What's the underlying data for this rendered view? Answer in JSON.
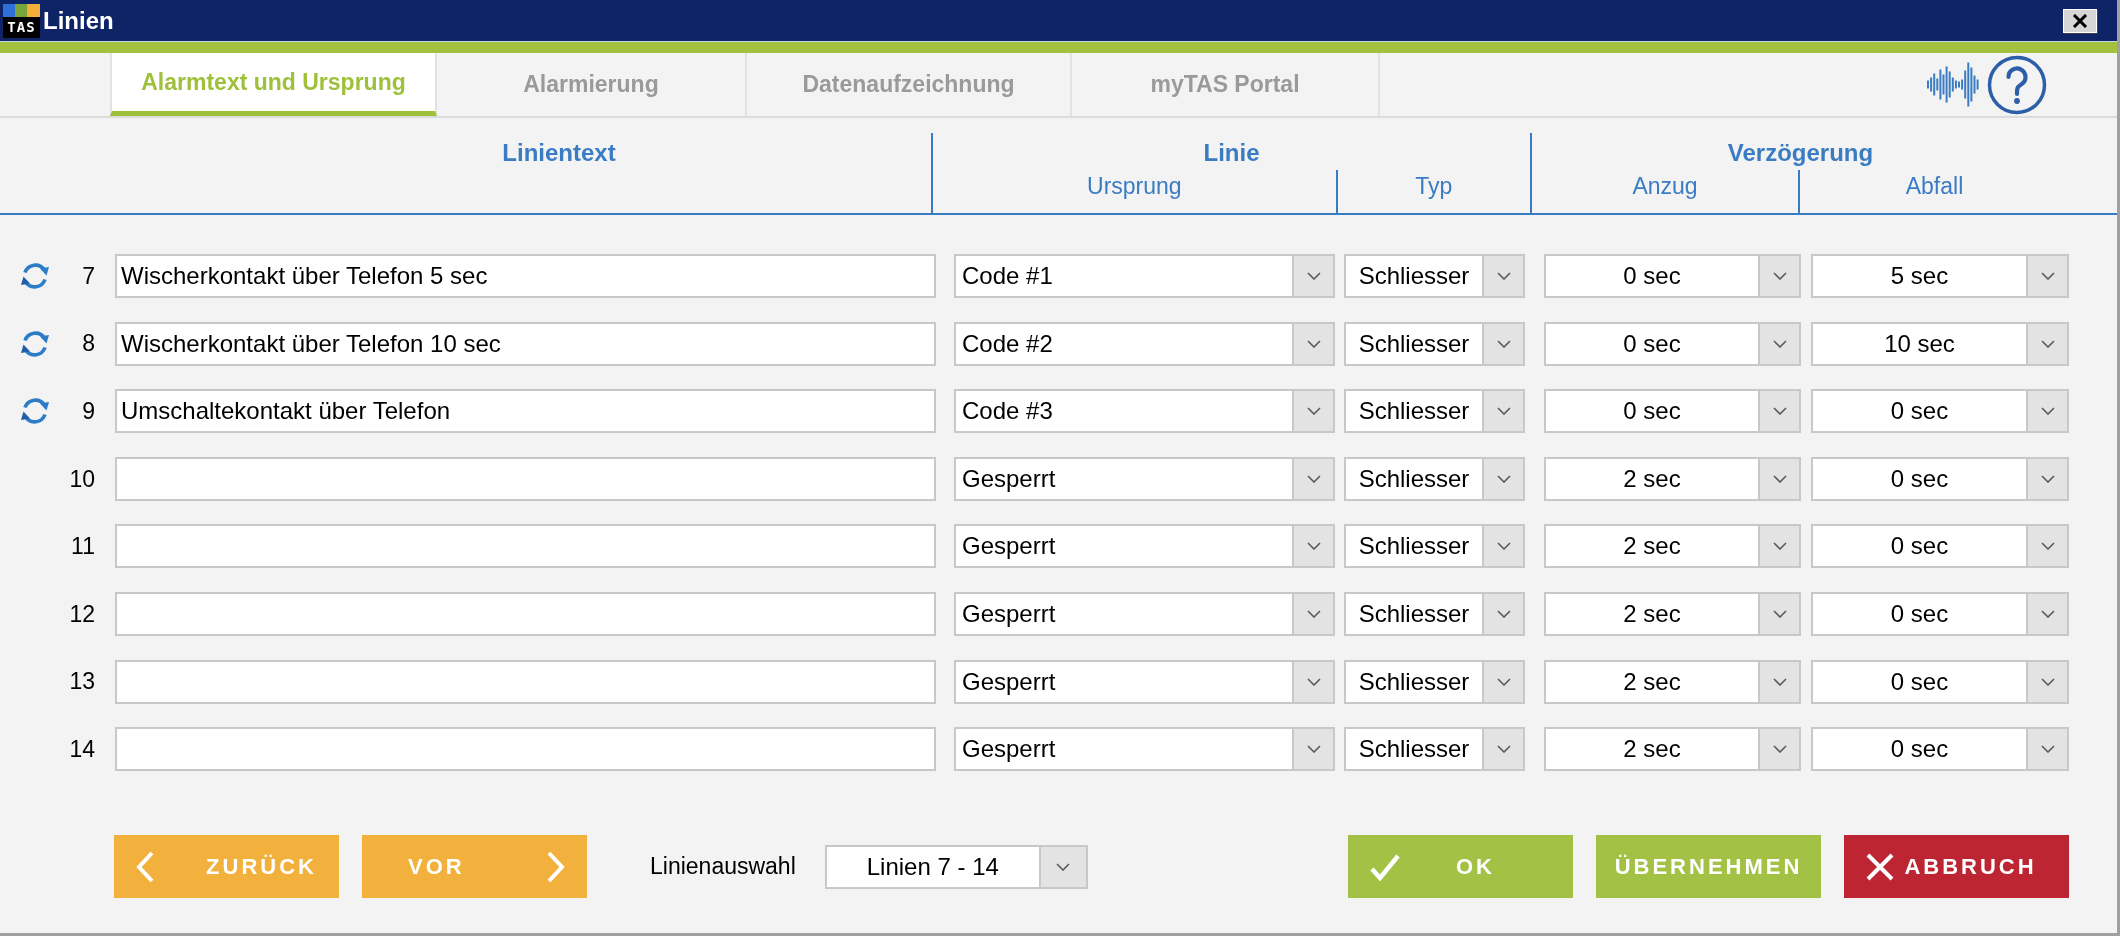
{
  "window": {
    "title": "Linien",
    "logo": "TAS"
  },
  "tabs": [
    {
      "label": "Alarmtext und Ursprung",
      "selected": true
    },
    {
      "label": "Alarmierung",
      "selected": false
    },
    {
      "label": "Datenaufzeichnung",
      "selected": false
    },
    {
      "label": "myTAS Portal",
      "selected": false
    }
  ],
  "header": {
    "text_column": "Linientext",
    "groups": [
      {
        "title": "Linie",
        "columns": [
          "Ursprung",
          "Typ"
        ]
      },
      {
        "title": "Verzögerung",
        "columns": [
          "Anzug",
          "Abfall"
        ]
      }
    ]
  },
  "rows": [
    {
      "number": "7",
      "sync": true,
      "text": "Wischerkontakt über Telefon 5 sec",
      "origin": "Code #1",
      "type": "Schliesser",
      "pickup": "0 sec",
      "dropout": "5 sec"
    },
    {
      "number": "8",
      "sync": true,
      "text": "Wischerkontakt über Telefon 10 sec",
      "origin": "Code #2",
      "type": "Schliesser",
      "pickup": "0 sec",
      "dropout": "10 sec"
    },
    {
      "number": "9",
      "sync": true,
      "text": "Umschaltekontakt über Telefon",
      "origin": "Code #3",
      "type": "Schliesser",
      "pickup": "0 sec",
      "dropout": "0 sec"
    },
    {
      "number": "10",
      "sync": false,
      "origin": "Gesperrt",
      "type": "Schliesser",
      "pickup": "2 sec",
      "dropout": "0 sec"
    },
    {
      "number": "11",
      "sync": false,
      "origin": "Gesperrt",
      "type": "Schliesser",
      "pickup": "2 sec",
      "dropout": "0 sec"
    },
    {
      "number": "12",
      "sync": false,
      "origin": "Gesperrt",
      "type": "Schliesser",
      "pickup": "2 sec",
      "dropout": "0 sec"
    },
    {
      "number": "13",
      "sync": false,
      "origin": "Gesperrt",
      "type": "Schliesser",
      "pickup": "2 sec",
      "dropout": "0 sec"
    },
    {
      "number": "14",
      "sync": false,
      "origin": "Gesperrt",
      "type": "Schliesser",
      "pickup": "2 sec",
      "dropout": "0 sec"
    }
  ],
  "footer": {
    "nav_buttons": [
      {
        "kind": "back",
        "label": "ZURÜCK"
      },
      {
        "kind": "forward",
        "label": "VOR"
      }
    ],
    "selector": {
      "label": "Linienauswahl",
      "value": "Linien 7 - 14"
    },
    "action_buttons": [
      {
        "kind": "ok",
        "label": "OK"
      },
      {
        "kind": "apply",
        "label": "ÜBERNEHMEN"
      },
      {
        "kind": "cancel",
        "label": "ABBRUCH"
      }
    ]
  }
}
